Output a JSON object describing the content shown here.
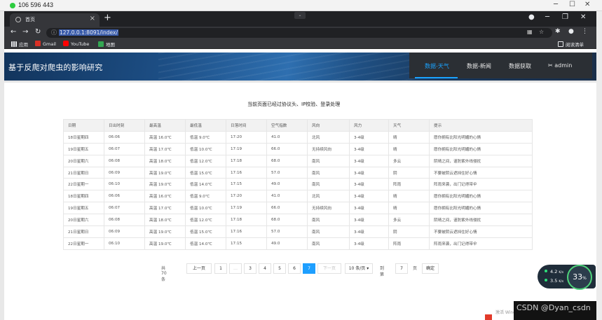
{
  "outer": {
    "number": "106 596 443"
  },
  "browser": {
    "tab_title": "首页",
    "url": "127.0.0.1:8091/index/",
    "bookmarks": [
      "应用",
      "Gmail",
      "YouTube",
      "地图"
    ],
    "reading_list": "阅读清单"
  },
  "site": {
    "title": "基于反爬对爬虫的影响研究",
    "nav": [
      "数据-天气",
      "数据-新闻",
      "数据获取"
    ],
    "user": "admin"
  },
  "notice": "当前页面已经过协议头、IP校验、登录处理",
  "table": {
    "headers": [
      "日期",
      "日出时刻",
      "最高温",
      "最低温",
      "日落时间",
      "空气指数",
      "风向",
      "风力",
      "天气",
      "提示"
    ],
    "rows": [
      [
        "18日星期四",
        "06:06",
        "高温 16.0℃",
        "低温 9.0℃",
        "17:20",
        "41.0",
        "北风",
        "3-4级",
        "晴",
        "愿你拥有比阳光明媚的心情"
      ],
      [
        "19日星期五",
        "06:07",
        "高温 17.0℃",
        "低温 10.0℃",
        "17:19",
        "66.0",
        "无持续风向",
        "3-4级",
        "晴",
        "愿你拥有比阳光明媚的心情"
      ],
      [
        "20日星期六",
        "06:08",
        "高温 18.0℃",
        "低温 12.0℃",
        "17:18",
        "68.0",
        "南风",
        "3-4级",
        "多云",
        "阴晴之间，谨防紫外线侵扰"
      ],
      [
        "21日星期日",
        "06:09",
        "高温 19.0℃",
        "低温 15.0℃",
        "17:16",
        "57.0",
        "南风",
        "3-4级",
        "阴",
        "不要被阴云遮挡住好心情"
      ],
      [
        "22日星期一",
        "06:10",
        "高温 19.0℃",
        "低温 14.0℃",
        "17:15",
        "49.0",
        "南风",
        "3-4级",
        "阵雨",
        "阵雨来袭，出门记得带伞"
      ],
      [
        "18日星期四",
        "06:06",
        "高温 16.0℃",
        "低温 9.0℃",
        "17:20",
        "41.0",
        "北风",
        "3-4级",
        "晴",
        "愿你拥有比阳光明媚的心情"
      ],
      [
        "19日星期五",
        "06:07",
        "高温 17.0℃",
        "低温 10.0℃",
        "17:19",
        "66.0",
        "无持续风向",
        "3-4级",
        "晴",
        "愿你拥有比阳光明媚的心情"
      ],
      [
        "20日星期六",
        "06:08",
        "高温 18.0℃",
        "低温 12.0℃",
        "17:18",
        "68.0",
        "南风",
        "3-4级",
        "多云",
        "阴晴之间，谨防紫外线侵扰"
      ],
      [
        "21日星期日",
        "06:09",
        "高温 19.0℃",
        "低温 15.0℃",
        "17:16",
        "57.0",
        "南风",
        "3-4级",
        "阴",
        "不要被阴云遮挡住好心情"
      ],
      [
        "22日星期一",
        "06:10",
        "高温 19.0℃",
        "低温 14.0℃",
        "17:15",
        "49.0",
        "南风",
        "3-4级",
        "阵雨",
        "阵雨来袭，出门记得带伞"
      ]
    ]
  },
  "pagination": {
    "total": "共 70 条",
    "prev": "上一页",
    "pages": [
      "1",
      "…",
      "3",
      "4",
      "5",
      "6",
      "7"
    ],
    "current": "7",
    "next": "下一页",
    "size": "10 条/页",
    "goto_label": "到第",
    "goto_value": "7",
    "page_unit": "页",
    "confirm": "确定"
  },
  "overlay": {
    "up_speed": "4.2",
    "down_speed": "3.5",
    "speed_unit": "K/s",
    "gauge": "33",
    "gauge_unit": "%",
    "watermark": "CSDN @Dyan_csdn",
    "activate": "激活 Windows"
  },
  "colors": {
    "accent": "#1e9fff",
    "nav_active": "#1aa3ff",
    "nav_bg": "#2b2f34"
  }
}
